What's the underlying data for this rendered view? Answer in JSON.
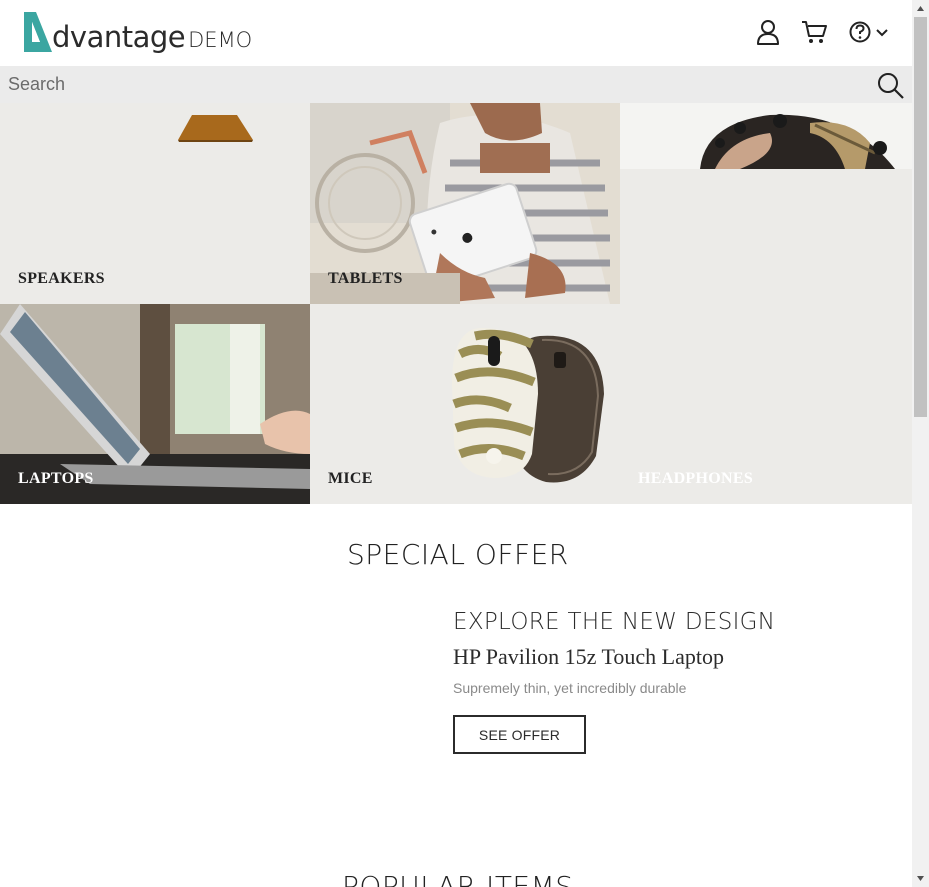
{
  "header": {
    "logo_word": "dvantage",
    "logo_suffix": "DEMO",
    "icons": [
      "user-icon",
      "cart-icon",
      "help-icon",
      "chevron-down-icon"
    ]
  },
  "search": {
    "placeholder": "Search",
    "value": ""
  },
  "categories": {
    "speakers": "SPEAKERS",
    "tablets": "TABLETS",
    "laptops": "LAPTOPS",
    "mice": "MICE",
    "headphones": "HEADPHONES"
  },
  "special_offer": {
    "title": "SPECIAL OFFER",
    "kicker": "EXPLORE THE NEW DESIGN",
    "product": "HP Pavilion 15z Touch Laptop",
    "description": "Supremely thin, yet incredibly durable",
    "button_label": "SEE OFFER"
  },
  "popular": {
    "title": "POPULAR ITEMS"
  },
  "colors": {
    "brand_teal": "#3ba6a1",
    "text_dark": "#2b2b2b",
    "search_bg": "#ebebeb"
  }
}
